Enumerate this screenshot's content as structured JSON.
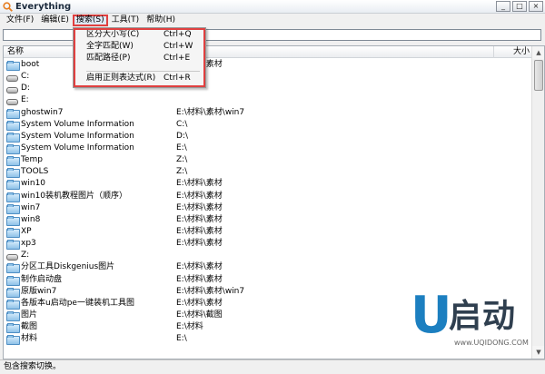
{
  "window": {
    "title": "Everything",
    "controls": [
      "_",
      "□",
      "×"
    ]
  },
  "menu": [
    {
      "label": "文件(F)"
    },
    {
      "label": "编辑(E)"
    },
    {
      "label": "搜索(S)"
    },
    {
      "label": "工具(T)"
    },
    {
      "label": "帮助(H)"
    }
  ],
  "search": {
    "value": ""
  },
  "dropdown": {
    "items": [
      {
        "label": "区分大小写(C)",
        "shortcut": "Ctrl+Q"
      },
      {
        "label": "全字匹配(W)",
        "shortcut": "Ctrl+W"
      },
      {
        "label": "匹配路径(P)",
        "shortcut": "Ctrl+E"
      },
      {
        "label": "启用正则表达式(R)",
        "shortcut": "Ctrl+R"
      }
    ]
  },
  "columns": {
    "name": "名称",
    "path": "",
    "size": "大小"
  },
  "rows": [
    {
      "icon": "folder",
      "name": "boot",
      "path": "E:\\材料\\素材"
    },
    {
      "icon": "drive",
      "name": "C:",
      "path": ""
    },
    {
      "icon": "drive",
      "name": "D:",
      "path": ""
    },
    {
      "icon": "drive",
      "name": "E:",
      "path": ""
    },
    {
      "icon": "folder",
      "name": "ghostwin7",
      "path": "E:\\材料\\素材\\win7"
    },
    {
      "icon": "folder",
      "name": "System Volume Information",
      "path": "C:\\"
    },
    {
      "icon": "folder",
      "name": "System Volume Information",
      "path": "D:\\"
    },
    {
      "icon": "folder",
      "name": "System Volume Information",
      "path": "E:\\"
    },
    {
      "icon": "folder",
      "name": "Temp",
      "path": "Z:\\"
    },
    {
      "icon": "folder",
      "name": "TOOLS",
      "path": "Z:\\"
    },
    {
      "icon": "folder",
      "name": "win10",
      "path": "E:\\材料\\素材"
    },
    {
      "icon": "folder",
      "name": "win10装机教程图片（顺序）",
      "path": "E:\\材料\\素材"
    },
    {
      "icon": "folder",
      "name": "win7",
      "path": "E:\\材料\\素材"
    },
    {
      "icon": "folder",
      "name": "win8",
      "path": "E:\\材料\\素材"
    },
    {
      "icon": "folder",
      "name": "XP",
      "path": "E:\\材料\\素材"
    },
    {
      "icon": "folder",
      "name": "xp3",
      "path": "E:\\材料\\素材"
    },
    {
      "icon": "drive",
      "name": "Z:",
      "path": ""
    },
    {
      "icon": "folder",
      "name": "分区工具Diskgenius图片",
      "path": "E:\\材料\\素材"
    },
    {
      "icon": "folder",
      "name": "制作启动盘",
      "path": "E:\\材料\\素材"
    },
    {
      "icon": "folder",
      "name": "原版win7",
      "path": "E:\\材料\\素材\\win7"
    },
    {
      "icon": "folder",
      "name": "各版本u启动pe一键装机工具图",
      "path": "E:\\材料\\素材"
    },
    {
      "icon": "folder",
      "name": "图片",
      "path": "E:\\材料\\截图"
    },
    {
      "icon": "folder",
      "name": "截图",
      "path": "E:\\材料"
    },
    {
      "icon": "folder",
      "name": "材料",
      "path": "E:\\"
    }
  ],
  "status": {
    "text": "包含搜索切换。"
  },
  "watermark": {
    "mark": "U",
    "text": "启动",
    "url": "www.UQIDONG.COM"
  }
}
